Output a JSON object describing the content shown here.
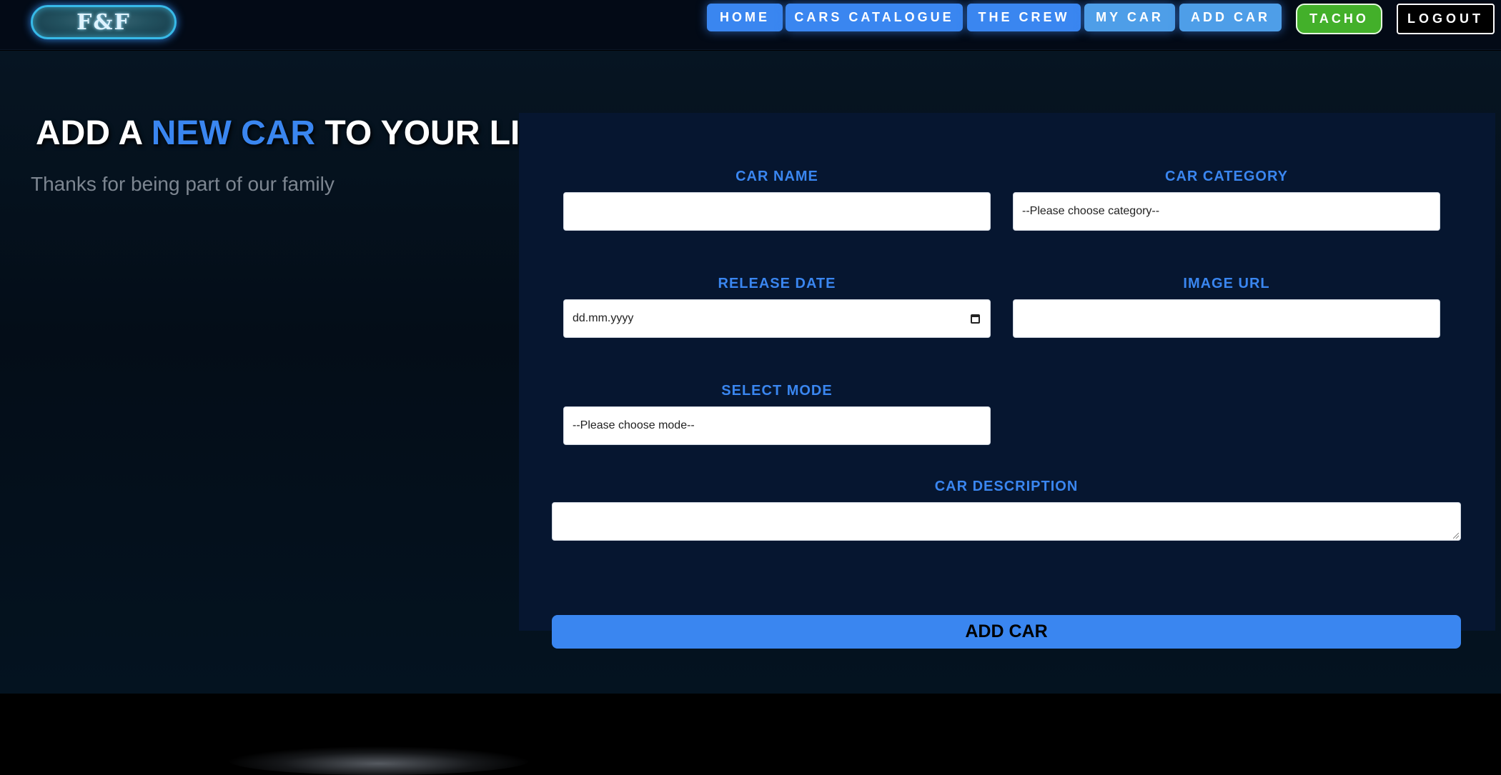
{
  "logo": {
    "text": "F&F"
  },
  "nav": {
    "items": [
      {
        "label": "HOME"
      },
      {
        "label": "CARS CATALOGUE"
      },
      {
        "label": "THE CREW"
      },
      {
        "label": "MY CAR"
      },
      {
        "label": "ADD CAR"
      }
    ],
    "tacho_label": "TACHO",
    "logout_label": "LOGOUT"
  },
  "intro": {
    "heading_part1": "ADD A ",
    "heading_accent": "NEW CAR",
    "heading_part2": " TO YOUR LIST",
    "subtext": "Thanks for being part of our family"
  },
  "form": {
    "car_name": {
      "label": "CAR NAME",
      "value": ""
    },
    "car_category": {
      "label": "CAR CATEGORY",
      "value": "--Please choose category--"
    },
    "release_date": {
      "label": "RELEASE DATE",
      "value": "dd.mm.yyyy"
    },
    "image_url": {
      "label": "IMAGE URL",
      "value": ""
    },
    "select_mode": {
      "label": "SELECT MODE",
      "value": "--Please choose mode--"
    },
    "car_description": {
      "label": "CAR DESCRIPTION",
      "value": ""
    },
    "submit_label": "ADD CAR"
  },
  "colors": {
    "accent": "#3a86f0",
    "tacho": "#43b02a",
    "panel": "#061630",
    "background": "#040d18"
  }
}
